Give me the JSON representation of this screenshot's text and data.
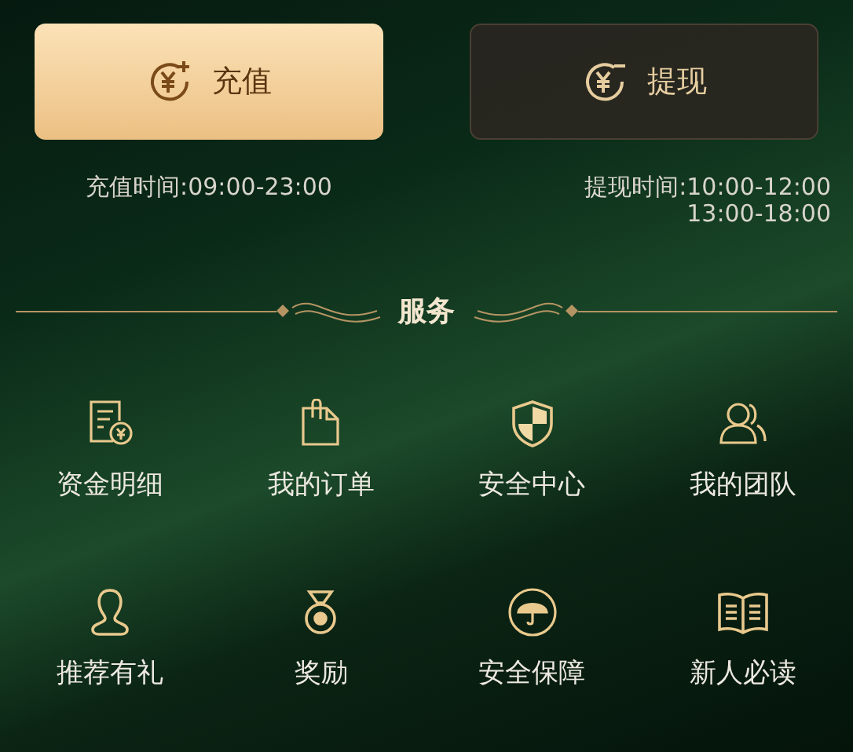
{
  "actions": [
    {
      "kind": "deposit",
      "label": "充值",
      "primary": true,
      "hours": [
        "充值时间:09:00-23:00"
      ]
    },
    {
      "kind": "withdraw",
      "label": "提现",
      "primary": false,
      "hours": [
        "提现时间:10:00-12:00",
        "13:00-18:00"
      ]
    }
  ],
  "section_title": "服务",
  "services": [
    {
      "kind": "statement",
      "label": "资金明细"
    },
    {
      "kind": "orders",
      "label": "我的订单"
    },
    {
      "kind": "shield",
      "label": "安全中心"
    },
    {
      "kind": "team",
      "label": "我的团队"
    },
    {
      "kind": "person",
      "label": "推荐有礼"
    },
    {
      "kind": "medal",
      "label": "奖励"
    },
    {
      "kind": "umbrella",
      "label": "安全保障"
    },
    {
      "kind": "book",
      "label": "新人必读"
    }
  ]
}
